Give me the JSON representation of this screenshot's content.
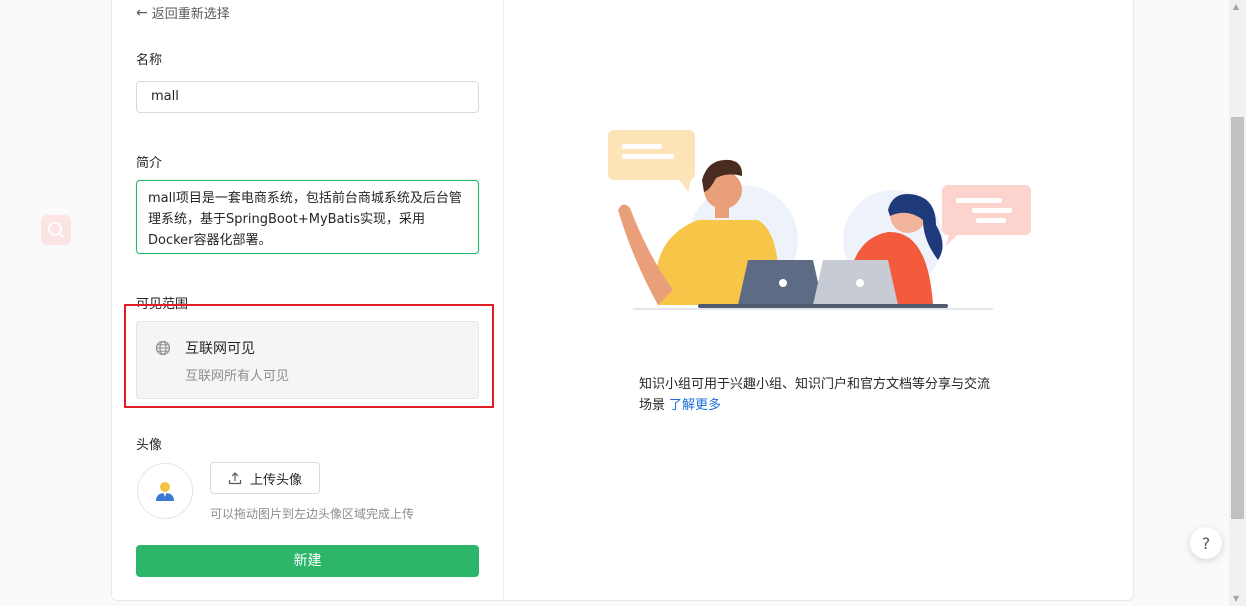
{
  "form": {
    "back_label": "返回重新选择",
    "name_label": "名称",
    "name_value": "mall",
    "intro_label": "简介",
    "intro_value": "mall项目是一套电商系统，包括前台商城系统及后台管理系统，基于SpringBoot+MyBatis实现，采用Docker容器化部署。",
    "visibility_label": "可见范围",
    "visibility_option": {
      "title": "互联网可见",
      "description": "互联网所有人可见",
      "icon": "globe-icon"
    },
    "avatar_label": "头像",
    "upload_label": "上传头像",
    "upload_hint": "可以拖动图片到左边头像区域完成上传",
    "create_label": "新建"
  },
  "info": {
    "description": "知识小组可用于兴趣小组、知识门户和官方文档等分享与交流场景",
    "learn_more": "了解更多"
  },
  "help": {
    "label": "?"
  },
  "colors": {
    "accent_green": "#2db66a",
    "highlight_red": "#e01e24",
    "link_blue": "#1e6fd9"
  }
}
